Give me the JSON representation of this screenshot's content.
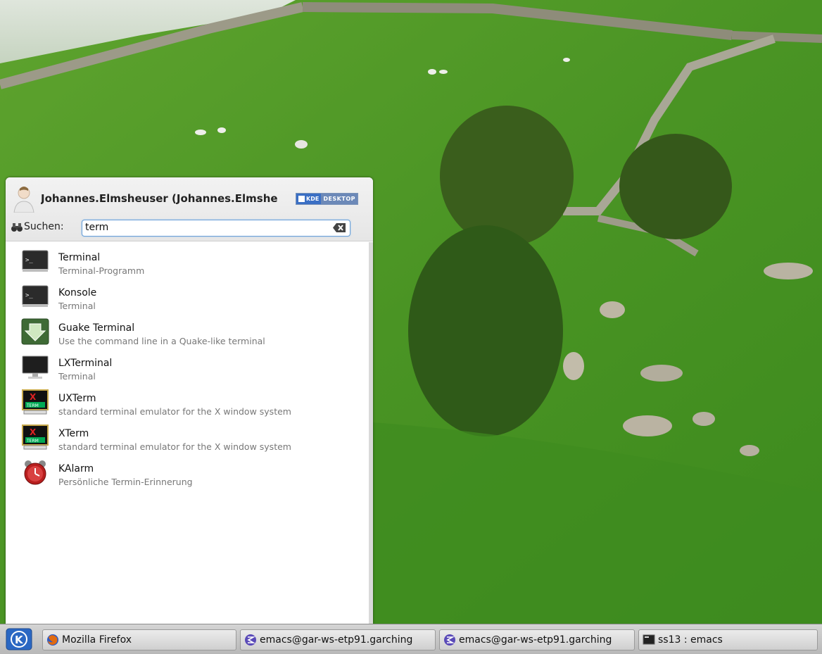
{
  "launcher": {
    "user_name": "Johannes.Elmsheuser (Johannes.Elmshe",
    "badge": {
      "left": "KDE",
      "right": "DESKTOP"
    },
    "search_label": "Suchen:",
    "search_value": "term",
    "results": [
      {
        "title": "Terminal",
        "subtitle": "Terminal-Programm",
        "icon": "terminal-icon"
      },
      {
        "title": "Konsole",
        "subtitle": "Terminal",
        "icon": "konsole-icon"
      },
      {
        "title": "Guake Terminal",
        "subtitle": "Use the command line in a Quake-like terminal",
        "icon": "guake-icon"
      },
      {
        "title": "LXTerminal",
        "subtitle": "Terminal",
        "icon": "monitor-icon"
      },
      {
        "title": "UXTerm",
        "subtitle": "standard terminal emulator for the X window system",
        "icon": "xterm-icon"
      },
      {
        "title": "XTerm",
        "subtitle": "standard terminal emulator for the X window system",
        "icon": "xterm-icon"
      },
      {
        "title": "KAlarm",
        "subtitle": "Persönliche Termin-Erinnerung",
        "icon": "alarm-clock-icon"
      }
    ]
  },
  "taskbar": {
    "tasks": [
      {
        "label": "Mozilla Firefox",
        "icon": "firefox-icon"
      },
      {
        "label": "emacs@gar-ws-etp91.garching",
        "icon": "emacs-icon"
      },
      {
        "label": "emacs@gar-ws-etp91.garching",
        "icon": "emacs-icon"
      },
      {
        "label": "ss13 : emacs",
        "icon": "terminal-icon"
      }
    ]
  },
  "colors": {
    "grass": "#4f9a2a",
    "accent": "#3a6fc4",
    "taskbar": "#c8c8c8"
  }
}
